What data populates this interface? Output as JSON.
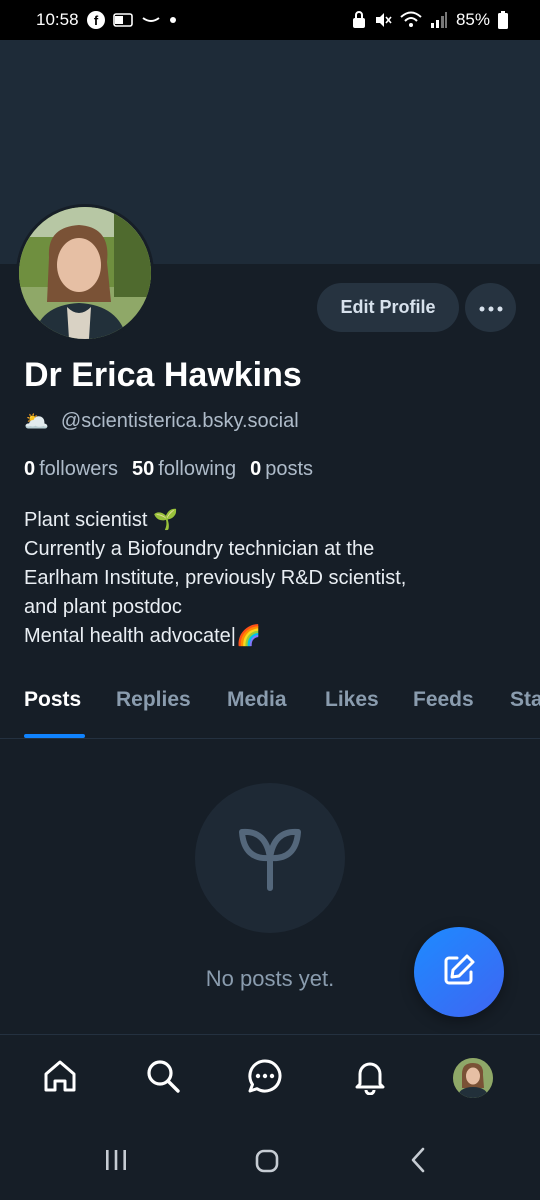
{
  "status_bar": {
    "time": "10:58",
    "battery": "85%",
    "left_icons": [
      "facebook-icon",
      "outlook-icon",
      "amazon-icon",
      "dot-icon"
    ],
    "right_icons": [
      "lock-icon",
      "mute-icon",
      "wifi-icon",
      "signal-icon",
      "battery-icon"
    ]
  },
  "profile": {
    "display_name": "Dr Erica Hawkins",
    "handle_emoji": "🌥️",
    "handle": "@scientisterica.bsky.social",
    "edit_button": "Edit Profile",
    "more_button_icon": "ellipsis-icon",
    "stats": {
      "followers_count": "0",
      "followers_label": "followers",
      "following_count": "50",
      "following_label": "following",
      "posts_count": "0",
      "posts_label": "posts"
    },
    "bio": [
      "Plant scientist 🌱",
      "Currently a Biofoundry technician at the",
      "Earlham Institute, previously R&D scientist,",
      "and plant postdoc",
      "Mental health advocate|🌈"
    ]
  },
  "tabs": [
    {
      "label": "Posts",
      "active": true
    },
    {
      "label": "Replies",
      "active": false
    },
    {
      "label": "Media",
      "active": false
    },
    {
      "label": "Likes",
      "active": false
    },
    {
      "label": "Feeds",
      "active": false
    },
    {
      "label": "Sta",
      "active": false
    }
  ],
  "empty_state": {
    "icon": "sprout-icon",
    "text": "No posts yet."
  },
  "fab": {
    "icon": "compose-icon"
  },
  "bottom_nav": [
    "home-icon",
    "search-icon",
    "chat-icon",
    "bell-icon",
    "profile-avatar"
  ],
  "system_nav": [
    "recents-icon",
    "home-button-icon",
    "back-icon"
  ],
  "colors": {
    "background": "#161e27",
    "banner": "#1e2b38",
    "accent": "#1083fe",
    "muted_text": "#8a9cae"
  }
}
